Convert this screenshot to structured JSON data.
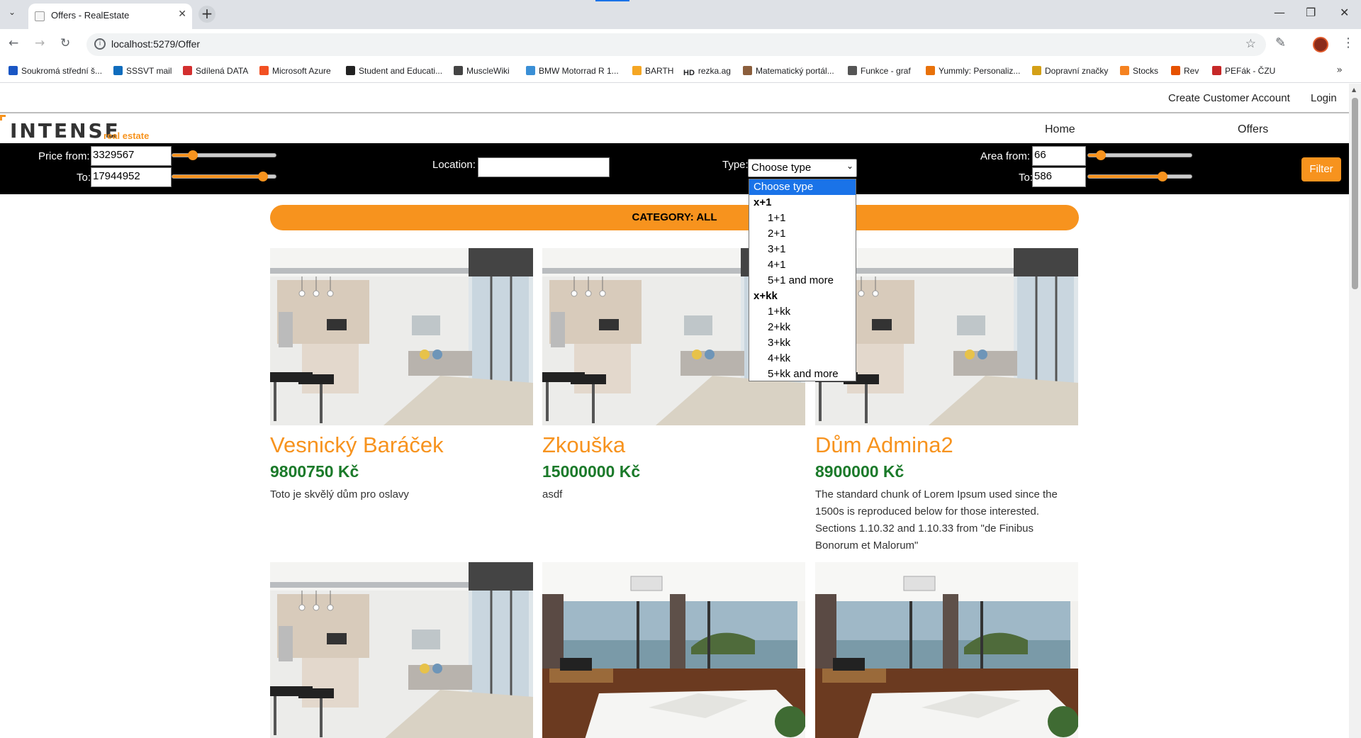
{
  "browser": {
    "tab_title": "Offers - RealEstate",
    "url": "localhost:5279/Offer",
    "bookmarks": [
      "Soukromá střední š...",
      "SSSVT mail",
      "Sdílená DATA",
      "Microsoft Azure",
      "Student and Educati...",
      "MuscleWiki",
      "BMW Motorrad R 1...",
      "BARTH",
      "rezka.ag",
      "Matematický portál...",
      "Funkce - graf",
      "Yummly: Personaliz...",
      "Dopravní značky",
      "Stocks",
      "Rev",
      "PEFák - ČZU"
    ],
    "bookmark_colors": [
      "#1a56c4",
      "#0f6cbd",
      "#d32f2f",
      "#f25022",
      "#222222",
      "#444444",
      "#3a8fd6",
      "#f5a623",
      "#111111",
      "#8b5e3c",
      "#555555",
      "#e8710a",
      "#d4a017",
      "#f58220",
      "#e65100",
      "#c62828"
    ],
    "bookmark_badges": [
      "",
      "",
      "",
      "",
      "",
      "",
      "",
      "",
      "HD",
      "",
      "",
      "",
      "",
      "",
      "",
      ""
    ]
  },
  "header": {
    "create_account": "Create Customer Account",
    "login": "Login",
    "brand": "INTENSE",
    "brand_sub": "real estate",
    "nav_home": "Home",
    "nav_offers": "Offers"
  },
  "filters": {
    "price_from_label": "Price from:",
    "price_from_value": "3329567",
    "price_to_label": "To:",
    "price_to_value": "17944952",
    "price_from_slider": 0.2,
    "price_to_slider": 0.88,
    "location_label": "Location:",
    "location_value": "",
    "type_label": "Type:",
    "type_selected": "Choose type",
    "area_from_label": "Area from:",
    "area_from_value": "66",
    "area_to_label": "To:",
    "area_to_value": "586",
    "area_from_slider": 0.12,
    "area_to_slider": 0.72,
    "filter_button": "Filter",
    "accent_color": "#f7931e"
  },
  "type_dropdown": {
    "options": [
      {
        "label": "Choose type",
        "kind": "selected"
      },
      {
        "label": "x+1",
        "kind": "group"
      },
      {
        "label": "1+1",
        "kind": "option"
      },
      {
        "label": "2+1",
        "kind": "option"
      },
      {
        "label": "3+1",
        "kind": "option"
      },
      {
        "label": "4+1",
        "kind": "option"
      },
      {
        "label": "5+1 and more",
        "kind": "option"
      },
      {
        "label": "x+kk",
        "kind": "group"
      },
      {
        "label": "1+kk",
        "kind": "option"
      },
      {
        "label": "2+kk",
        "kind": "option"
      },
      {
        "label": "3+kk",
        "kind": "option"
      },
      {
        "label": "4+kk",
        "kind": "option"
      },
      {
        "label": "5+kk and more",
        "kind": "option"
      }
    ]
  },
  "category": {
    "label": "CATEGORY: ALL"
  },
  "offers": [
    {
      "title": "Vesnický Baráček",
      "price": "9800750 Kč",
      "description": "Toto je skvělý dům pro oslavy",
      "image": "kitchen"
    },
    {
      "title": "Zkouška",
      "price": "15000000 Kč",
      "description": "asdf",
      "image": "kitchen"
    },
    {
      "title": "Dům Admina2",
      "price": "8900000 Kč",
      "description": "The standard chunk of Lorem Ipsum used since the 1500s is reproduced below for those interested. Sections 1.10.32 and 1.10.33 from \"de Finibus Bonorum et Malorum\"",
      "image": "kitchen"
    },
    {
      "title": "",
      "price": "",
      "description": "",
      "image": "kitchen"
    },
    {
      "title": "",
      "price": "",
      "description": "",
      "image": "bedroom"
    },
    {
      "title": "",
      "price": "",
      "description": "",
      "image": "bedroom"
    }
  ]
}
